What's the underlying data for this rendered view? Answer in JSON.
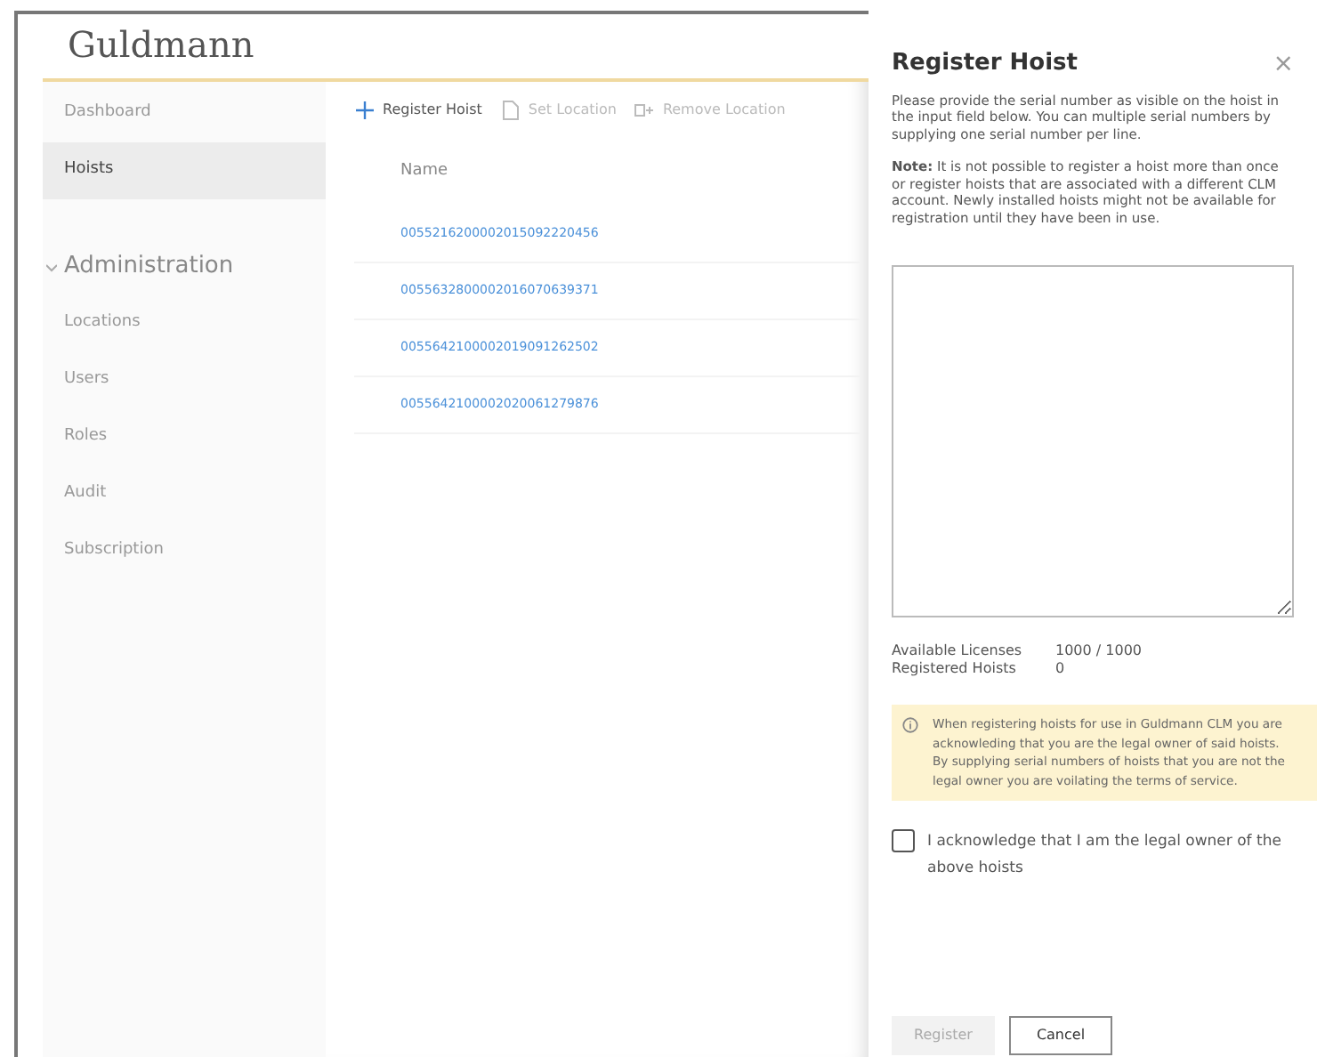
{
  "logo": "Guldmann",
  "sidebar": {
    "items": [
      {
        "label": "Dashboard",
        "selected": false
      },
      {
        "label": "Hoists",
        "selected": true
      }
    ],
    "groups": [
      {
        "label": "Administration",
        "expanded": true,
        "children": [
          {
            "label": "Locations",
            "selected": false
          },
          {
            "label": "Users",
            "selected": false
          },
          {
            "label": "Roles",
            "selected": false
          },
          {
            "label": "Audit",
            "selected": false
          },
          {
            "label": "Subscription",
            "selected": false
          }
        ]
      }
    ]
  },
  "toolbar": [
    {
      "label": "Register Hoist",
      "kind": "add",
      "disabled": false
    },
    {
      "label": "Set Location",
      "kind": "document",
      "disabled": true
    },
    {
      "label": "Remove Location",
      "kind": "remove",
      "disabled": true
    }
  ],
  "table": {
    "columns": [
      "Name"
    ],
    "rows": [
      "0055216200002015092220456",
      "0055632800002016070639371",
      "0055642100002019091262502",
      "0055642100002020061279876"
    ]
  },
  "panel": {
    "title": "Register Hoist",
    "close": "×",
    "intro": "Please provide the serial number as visible on the hoist in the input field below. You can multiple serial numbers by supplying one serial number per line.",
    "note": "**Note:** It is not possible to register a hoist more than once or register hoists that are associated with a different CLM account. Newly installed hoists might not be available for registration until they have been in use.",
    "stats": [
      {
        "label": "Available Licenses",
        "value": "1000 / 1000"
      },
      {
        "label": "Registered Hoists",
        "value": "0"
      }
    ],
    "warning": "When registering hoists for use in Guldmann CLM you are acknowleding that you are the legal owner of said hoists. By supplying serial numbers of hoists that you are not the legal owner you are voilating the terms of service.",
    "acknowledge": {
      "label": "I acknowledge that I am the legal owner of the above hoists",
      "checked": false
    },
    "buttons": [
      {
        "label": "Register",
        "disabled": true
      },
      {
        "label": "Cancel",
        "disabled": false
      }
    ]
  }
}
